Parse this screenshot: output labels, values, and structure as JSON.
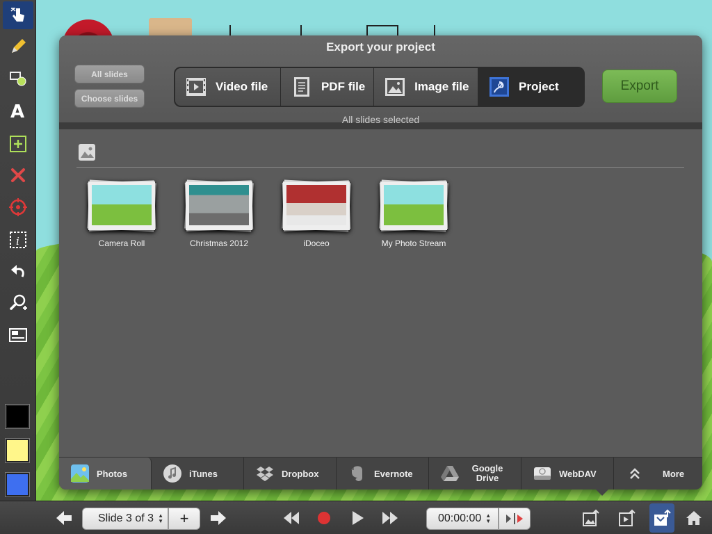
{
  "dialog": {
    "title": "Export your project",
    "all_slides_label": "All slides",
    "choose_slides_label": "Choose slides",
    "formats": [
      {
        "label": "Video file",
        "icon": "film-icon"
      },
      {
        "label": "PDF file",
        "icon": "document-icon"
      },
      {
        "label": "Image file",
        "icon": "picture-icon"
      },
      {
        "label": "Project",
        "icon": "project-icon",
        "active": true
      }
    ],
    "export_label": "Export",
    "selection_status": "All slides selected",
    "albums": [
      {
        "label": "Camera Roll"
      },
      {
        "label": "Christmas 2012"
      },
      {
        "label": "iDoceo"
      },
      {
        "label": "My Photo Stream"
      }
    ],
    "sources": [
      {
        "label": "Photos",
        "icon": "photos-icon",
        "active": true
      },
      {
        "label": "iTunes",
        "icon": "music-note-icon"
      },
      {
        "label": "Dropbox",
        "icon": "dropbox-icon"
      },
      {
        "label": "Evernote",
        "icon": "evernote-icon"
      },
      {
        "label": "Google Drive",
        "icon": "google-drive-icon"
      },
      {
        "label": "WebDAV",
        "icon": "drive-icon"
      },
      {
        "label": "More",
        "icon": "chevron-up-icon"
      }
    ]
  },
  "bottom_bar": {
    "slide_indicator": "Slide 3 of 3",
    "add_label": "+",
    "timer": "00:00:00"
  },
  "colors": {
    "accent_green": "#6cab49",
    "swatch_black": "#000000",
    "swatch_yellow": "#fff68a",
    "swatch_blue": "#3e6ff0"
  }
}
